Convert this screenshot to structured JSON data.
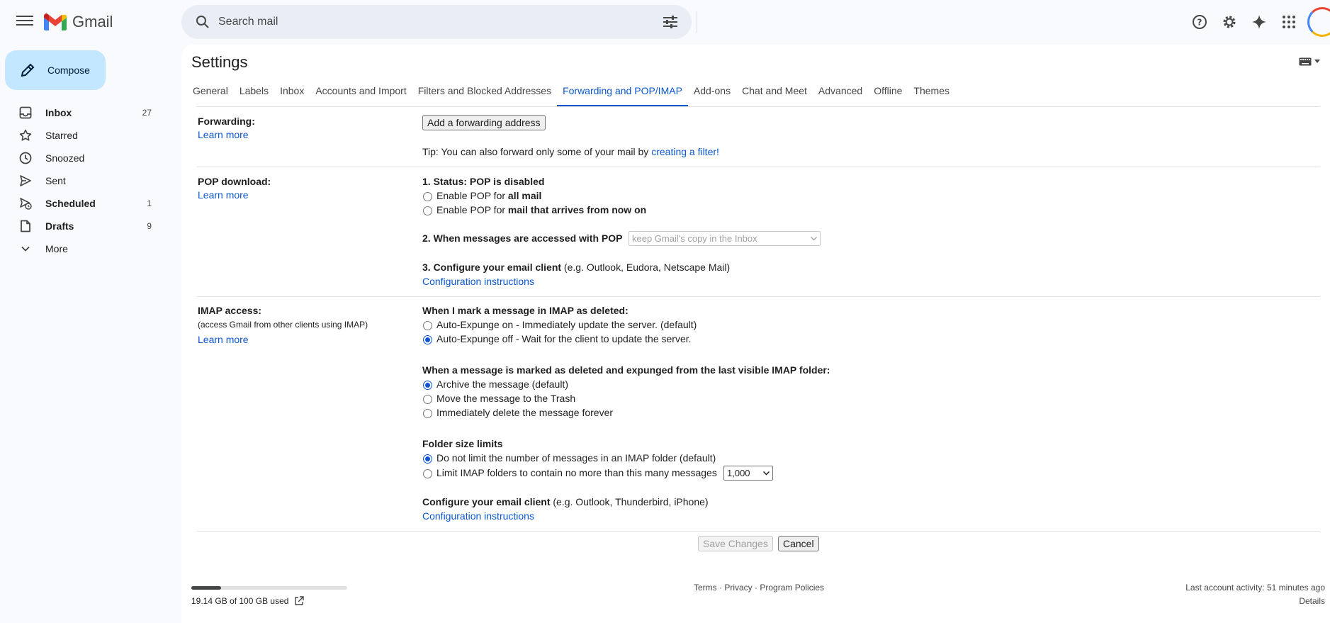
{
  "app": {
    "name": "Gmail"
  },
  "search": {
    "placeholder": "Search mail"
  },
  "compose": {
    "label": "Compose"
  },
  "nav": [
    {
      "label": "Inbox",
      "count": "27",
      "icon": "inbox-icon",
      "bold": true
    },
    {
      "label": "Starred",
      "count": "",
      "icon": "star-icon",
      "bold": false
    },
    {
      "label": "Snoozed",
      "count": "",
      "icon": "clock-icon",
      "bold": false
    },
    {
      "label": "Sent",
      "count": "",
      "icon": "send-icon",
      "bold": false
    },
    {
      "label": "Scheduled",
      "count": "1",
      "icon": "scheduled-icon",
      "bold": true
    },
    {
      "label": "Drafts",
      "count": "9",
      "icon": "draft-icon",
      "bold": true
    },
    {
      "label": "More",
      "count": "",
      "icon": "chevron-down-icon",
      "bold": false
    }
  ],
  "settings": {
    "title": "Settings",
    "tabs": [
      "General",
      "Labels",
      "Inbox",
      "Accounts and Import",
      "Filters and Blocked Addresses",
      "Forwarding and POP/IMAP",
      "Add-ons",
      "Chat and Meet",
      "Advanced",
      "Offline",
      "Themes"
    ],
    "active_tab": "Forwarding and POP/IMAP"
  },
  "forwarding": {
    "label": "Forwarding:",
    "learn_more": "Learn more",
    "add_button": "Add a forwarding address",
    "tip_prefix": "Tip: You can also forward only some of your mail by ",
    "tip_link": "creating a filter!"
  },
  "pop": {
    "label": "POP download:",
    "learn_more": "Learn more",
    "status": "1. Status: POP is disabled",
    "opt1_prefix": "Enable POP for ",
    "opt1_bold": "all mail",
    "opt2_prefix": "Enable POP for ",
    "opt2_bold": "mail that arrives from now on",
    "when_accessed": "2. When messages are accessed with POP",
    "when_accessed_select": "keep Gmail's copy in the Inbox",
    "configure_bold": "3. Configure your email client",
    "configure_rest": " (e.g. Outlook, Eudora, Netscape Mail)",
    "config_link": "Configuration instructions"
  },
  "imap": {
    "label": "IMAP access:",
    "sublabel": "(access Gmail from other clients using IMAP)",
    "learn_more": "Learn more",
    "deleted_heading": "When I mark a message in IMAP as deleted:",
    "deleted_opt1": "Auto-Expunge on - Immediately update the server. (default)",
    "deleted_opt2": "Auto-Expunge off - Wait for the client to update the server.",
    "expunged_heading": "When a message is marked as deleted and expunged from the last visible IMAP folder:",
    "expunged_opt1": "Archive the message (default)",
    "expunged_opt2": "Move the message to the Trash",
    "expunged_opt3": "Immediately delete the message forever",
    "folder_heading": "Folder size limits",
    "folder_opt1": "Do not limit the number of messages in an IMAP folder (default)",
    "folder_opt2": "Limit IMAP folders to contain no more than this many messages",
    "folder_select": "1,000",
    "configure_bold": "Configure your email client",
    "configure_rest": " (e.g. Outlook, Thunderbird, iPhone)",
    "config_link": "Configuration instructions"
  },
  "actions": {
    "save": "Save Changes",
    "cancel": "Cancel"
  },
  "footer": {
    "storage": "19.14 GB of 100 GB used",
    "storage_fraction": 0.1914,
    "terms": "Terms",
    "privacy": "Privacy",
    "policies": "Program Policies",
    "dot": " · ",
    "activity": "Last account activity: 51 minutes ago",
    "details": "Details"
  },
  "colors": {
    "accent": "#0b57d0",
    "compose_bg": "#c2e7ff",
    "search_bg": "#e9eef6"
  }
}
